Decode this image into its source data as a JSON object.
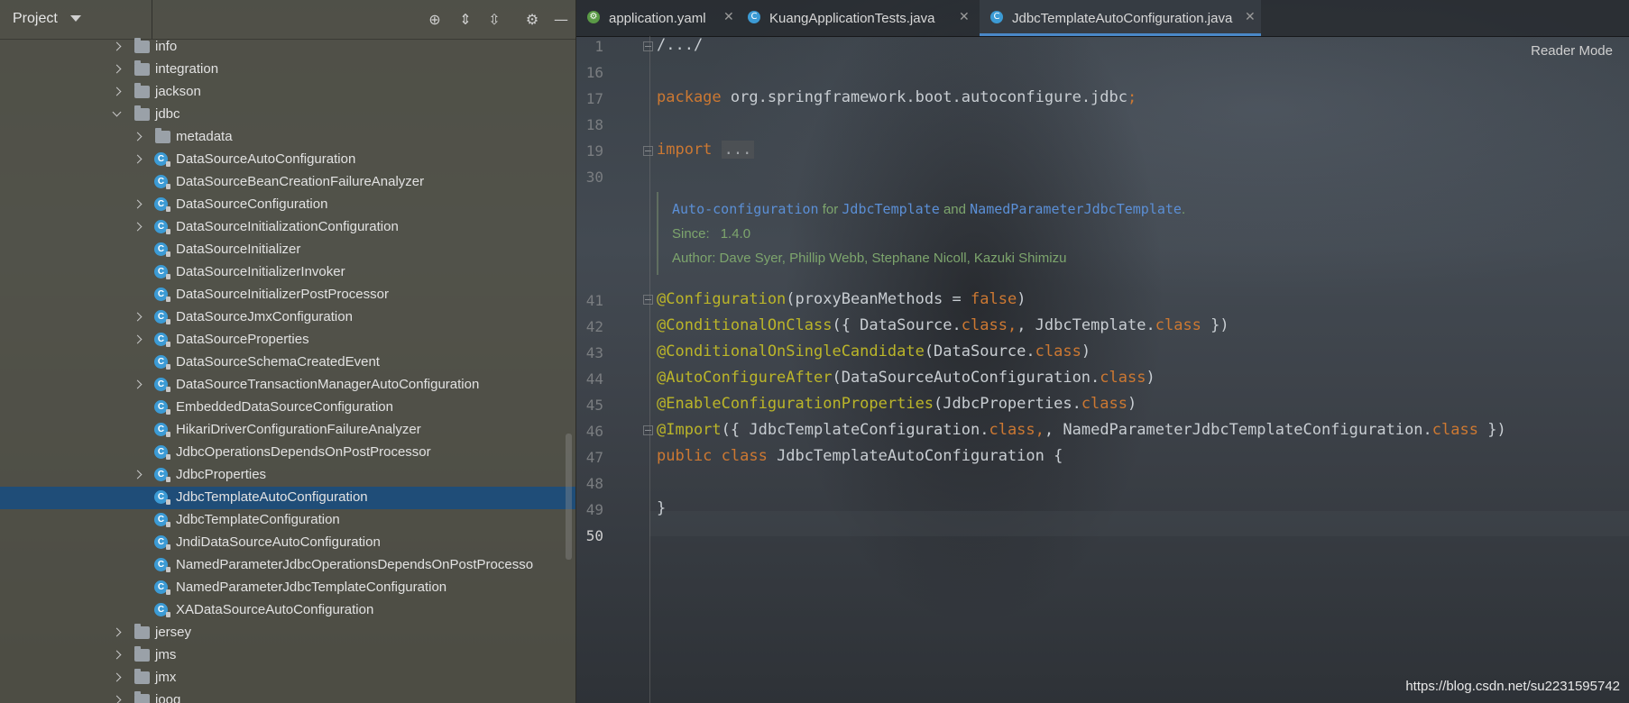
{
  "project_panel": {
    "title": "Project",
    "tree": [
      {
        "label": "info",
        "type": "folder",
        "arrow": "right"
      },
      {
        "label": "integration",
        "type": "folder",
        "arrow": "right"
      },
      {
        "label": "jackson",
        "type": "folder",
        "arrow": "right"
      },
      {
        "label": "jdbc",
        "type": "folder",
        "arrow": "down"
      },
      {
        "label": "metadata",
        "type": "folder",
        "arrow": "right"
      },
      {
        "label": "DataSourceAutoConfiguration",
        "type": "class",
        "arrow": "right"
      },
      {
        "label": "DataSourceBeanCreationFailureAnalyzer",
        "type": "class",
        "arrow": "none"
      },
      {
        "label": "DataSourceConfiguration",
        "type": "class",
        "arrow": "right"
      },
      {
        "label": "DataSourceInitializationConfiguration",
        "type": "class",
        "arrow": "right"
      },
      {
        "label": "DataSourceInitializer",
        "type": "class",
        "arrow": "none"
      },
      {
        "label": "DataSourceInitializerInvoker",
        "type": "class",
        "arrow": "none"
      },
      {
        "label": "DataSourceInitializerPostProcessor",
        "type": "class",
        "arrow": "none"
      },
      {
        "label": "DataSourceJmxConfiguration",
        "type": "class",
        "arrow": "right"
      },
      {
        "label": "DataSourceProperties",
        "type": "class",
        "arrow": "right"
      },
      {
        "label": "DataSourceSchemaCreatedEvent",
        "type": "class",
        "arrow": "none"
      },
      {
        "label": "DataSourceTransactionManagerAutoConfiguration",
        "type": "class",
        "arrow": "right"
      },
      {
        "label": "EmbeddedDataSourceConfiguration",
        "type": "class",
        "arrow": "none"
      },
      {
        "label": "HikariDriverConfigurationFailureAnalyzer",
        "type": "class",
        "arrow": "none"
      },
      {
        "label": "JdbcOperationsDependsOnPostProcessor",
        "type": "class",
        "arrow": "none"
      },
      {
        "label": "JdbcProperties",
        "type": "class",
        "arrow": "right"
      },
      {
        "label": "JdbcTemplateAutoConfiguration",
        "type": "class",
        "arrow": "none",
        "selected": true
      },
      {
        "label": "JdbcTemplateConfiguration",
        "type": "class",
        "arrow": "none"
      },
      {
        "label": "JndiDataSourceAutoConfiguration",
        "type": "class",
        "arrow": "none"
      },
      {
        "label": "NamedParameterJdbcOperationsDependsOnPostProcesso",
        "type": "class",
        "arrow": "none"
      },
      {
        "label": "NamedParameterJdbcTemplateConfiguration",
        "type": "class",
        "arrow": "none"
      },
      {
        "label": "XADataSourceAutoConfiguration",
        "type": "class",
        "arrow": "none"
      },
      {
        "label": "jersey",
        "type": "folder",
        "arrow": "right"
      },
      {
        "label": "jms",
        "type": "folder",
        "arrow": "right"
      },
      {
        "label": "jmx",
        "type": "folder",
        "arrow": "right"
      },
      {
        "label": "jooq",
        "type": "folder",
        "arrow": "right"
      }
    ]
  },
  "editor": {
    "tabs": [
      {
        "label": "application.yaml",
        "active": false
      },
      {
        "label": "KuangApplicationTests.java",
        "active": false
      },
      {
        "label": "JdbcTemplateAutoConfiguration.java",
        "active": true
      }
    ],
    "reader_mode": "Reader Mode",
    "line_numbers": [
      "1",
      "16",
      "17",
      "18",
      "19",
      "30",
      "41",
      "42",
      "43",
      "44",
      "45",
      "46",
      "47",
      "48",
      "49",
      "50"
    ],
    "doc": {
      "line1_a": "Auto-configuration",
      "line1_b": " for ",
      "line1_c": "JdbcTemplate",
      "line1_d": " and ",
      "line1_e": "NamedParameterJdbcTemplate",
      "line1_f": ".",
      "since_label": "Since:",
      "since_value": "1.4.0",
      "author": "Author: Dave Syer, Phillip Webb, Stephane Nicoll, Kazuki Shimizu"
    },
    "code": {
      "l1": "/.../",
      "l17_kw": "package",
      "l17_rest": " org.springframework.boot.autoconfigure.jdbc",
      "l17_semi": ";",
      "l19_kw": "import",
      "l19_folded": "...",
      "l41_an": "@Configuration",
      "l41_a": "(proxyBeanMethods = ",
      "l41_kw": "false",
      "l41_b": ")",
      "l42_an": "@ConditionalOnClass",
      "l42_a": "({ DataSource.",
      "l42_kw1": "class",
      "l42_b": ", JdbcTemplate.",
      "l42_kw2": "class",
      "l42_c": " })",
      "l43_an": "@ConditionalOnSingleCandidate",
      "l43_a": "(DataSource.",
      "l43_kw": "class",
      "l43_b": ")",
      "l44_an": "@AutoConfigureAfter",
      "l44_a": "(DataSourceAutoConfiguration.",
      "l44_kw": "class",
      "l44_b": ")",
      "l45_an": "@EnableConfigurationProperties",
      "l45_a": "(JdbcProperties.",
      "l45_kw": "class",
      "l45_b": ")",
      "l46_an": "@Import",
      "l46_a": "({ JdbcTemplateConfiguration.",
      "l46_kw1": "class",
      "l46_b": ", NamedParameterJdbcTemplateConfiguration.",
      "l46_kw2": "class",
      "l46_c": " })",
      "l47_kw": "public class",
      "l47_rest": " JdbcTemplateAutoConfiguration {",
      "l49": "}"
    }
  },
  "watermark": "https://blog.csdn.net/su2231595742",
  "colors": {
    "accent": "#4a88c7",
    "selection": "#1f4d78",
    "keyword": "#cc7832",
    "annotation": "#bbb529",
    "doc": "#7da56d"
  }
}
